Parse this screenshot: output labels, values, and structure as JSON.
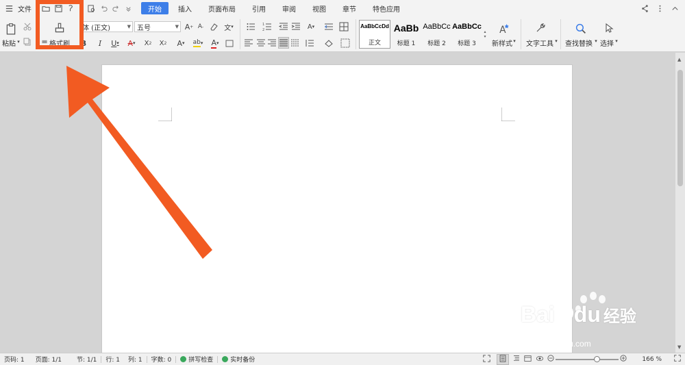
{
  "menubar": {
    "file_label": "文件",
    "tabs": [
      {
        "label": "开始",
        "active": true
      },
      {
        "label": "插入",
        "active": false
      },
      {
        "label": "页面布局",
        "active": false
      },
      {
        "label": "引用",
        "active": false
      },
      {
        "label": "审阅",
        "active": false
      },
      {
        "label": "视图",
        "active": false
      },
      {
        "label": "章节",
        "active": false
      },
      {
        "label": "特色应用",
        "active": false
      }
    ]
  },
  "ribbon": {
    "paste_label": "粘贴",
    "format_painter_label": "格式刷",
    "font_name": "体 (正文)",
    "font_size": "五号",
    "styles": [
      {
        "sample": "AaBbCcDd",
        "name": "正文"
      },
      {
        "sample": "AaBb",
        "name": "标题 1"
      },
      {
        "sample": "AaBbCc",
        "name": "标题 2"
      },
      {
        "sample": "AaBbCc",
        "name": "标题 3"
      }
    ],
    "new_style_label": "新样式",
    "text_tools_label": "文字工具",
    "find_replace_label": "查找替换",
    "select_label": "选择"
  },
  "statusbar": {
    "page_num": "页码: 1",
    "pages": "页面: 1/1",
    "section": "节: 1/1",
    "row": "行: 1",
    "column": "列: 1",
    "word_count": "字数: 0",
    "spell_check": "拼写检查",
    "backup": "实时备份",
    "zoom": "166 %"
  },
  "zoom_level_fraction": 0.67,
  "colors": {
    "accent": "#3d7ee8",
    "annotation": "#f25b22",
    "status_green": "#3aa85c"
  },
  "watermark": {
    "brand": "Bai",
    "brand2": "du",
    "chinese": "经验",
    "url": "jingyan.baidu.com"
  }
}
